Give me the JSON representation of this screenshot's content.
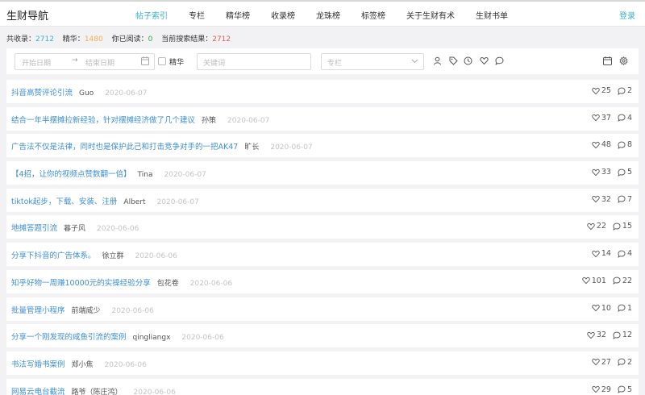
{
  "header": {
    "brand": "生财导航",
    "nav": [
      "帖子索引",
      "专栏",
      "精华榜",
      "收录榜",
      "龙珠榜",
      "标签榜",
      "关于生财有术",
      "生财书单"
    ],
    "active_nav": "帖子索引",
    "login": "登录"
  },
  "stats": {
    "total_label": "共收录：",
    "total": "2712",
    "essence_label": "精华：",
    "essence": "1480",
    "read_label": "你已阅读：",
    "read": "0",
    "search_label": "当前搜索结果：",
    "search": "2712"
  },
  "filters": {
    "start_placeholder": "开始日期",
    "arrow": "→",
    "end_placeholder": "结束日期",
    "essence_label": "精华",
    "keyword_placeholder": "关键词",
    "column_placeholder": "专栏"
  },
  "posts": [
    {
      "title": "抖音高赞评论引流",
      "author": "Guo",
      "date": "2020-06-07",
      "likes": "25",
      "comments": "2"
    },
    {
      "title": "结合一年半摆摊拉新经验，针对摆摊经济做了几个建议",
      "author": "孙策",
      "date": "2020-06-07",
      "likes": "37",
      "comments": "4"
    },
    {
      "title": "广告法不仅是法律，同时也是保护此己和打击竞争对手的一把AK47",
      "author": "旷长",
      "date": "2020-06-07",
      "likes": "48",
      "comments": "8"
    },
    {
      "title": "【4招，让你的视频点赞数翻一倍】",
      "author": "Tina",
      "date": "2020-06-07",
      "likes": "33",
      "comments": "5"
    },
    {
      "title": "tiktok起步，下载、安装、注册",
      "author": "Albert",
      "date": "2020-06-07",
      "likes": "32",
      "comments": "7"
    },
    {
      "title": "地摊答题引流",
      "author": "暮子风",
      "date": "2020-06-06",
      "likes": "22",
      "comments": "15"
    },
    {
      "title": "分享下抖音的广告体系。",
      "author": "徐立群",
      "date": "2020-06-06",
      "likes": "14",
      "comments": "4"
    },
    {
      "title": "知乎好物一周赚10000元的实操经验分享",
      "author": "包花卷",
      "date": "2020-06-06",
      "likes": "101",
      "comments": "22"
    },
    {
      "title": "批量管理小程序",
      "author": "前端威少",
      "date": "2020-06-06",
      "likes": "10",
      "comments": "1"
    },
    {
      "title": "分享一个刚发现的咸鱼引流的案例",
      "author": "qingliangx",
      "date": "2020-06-06",
      "likes": "32",
      "comments": "12"
    },
    {
      "title": "书法写婚书案例",
      "author": "郑小焦",
      "date": "2020-06-06",
      "likes": "27",
      "comments": "2"
    },
    {
      "title": "网易云电台截流",
      "author": "路爷（陈庄鸿）",
      "date": "2020-06-06",
      "likes": "29",
      "comments": "5"
    }
  ],
  "colors": {
    "accent": "#3ab0c6",
    "title_link": "#3c8fd8",
    "essence": "#f0ad4e",
    "read": "#2ba84a",
    "search": "#e05a5a"
  }
}
